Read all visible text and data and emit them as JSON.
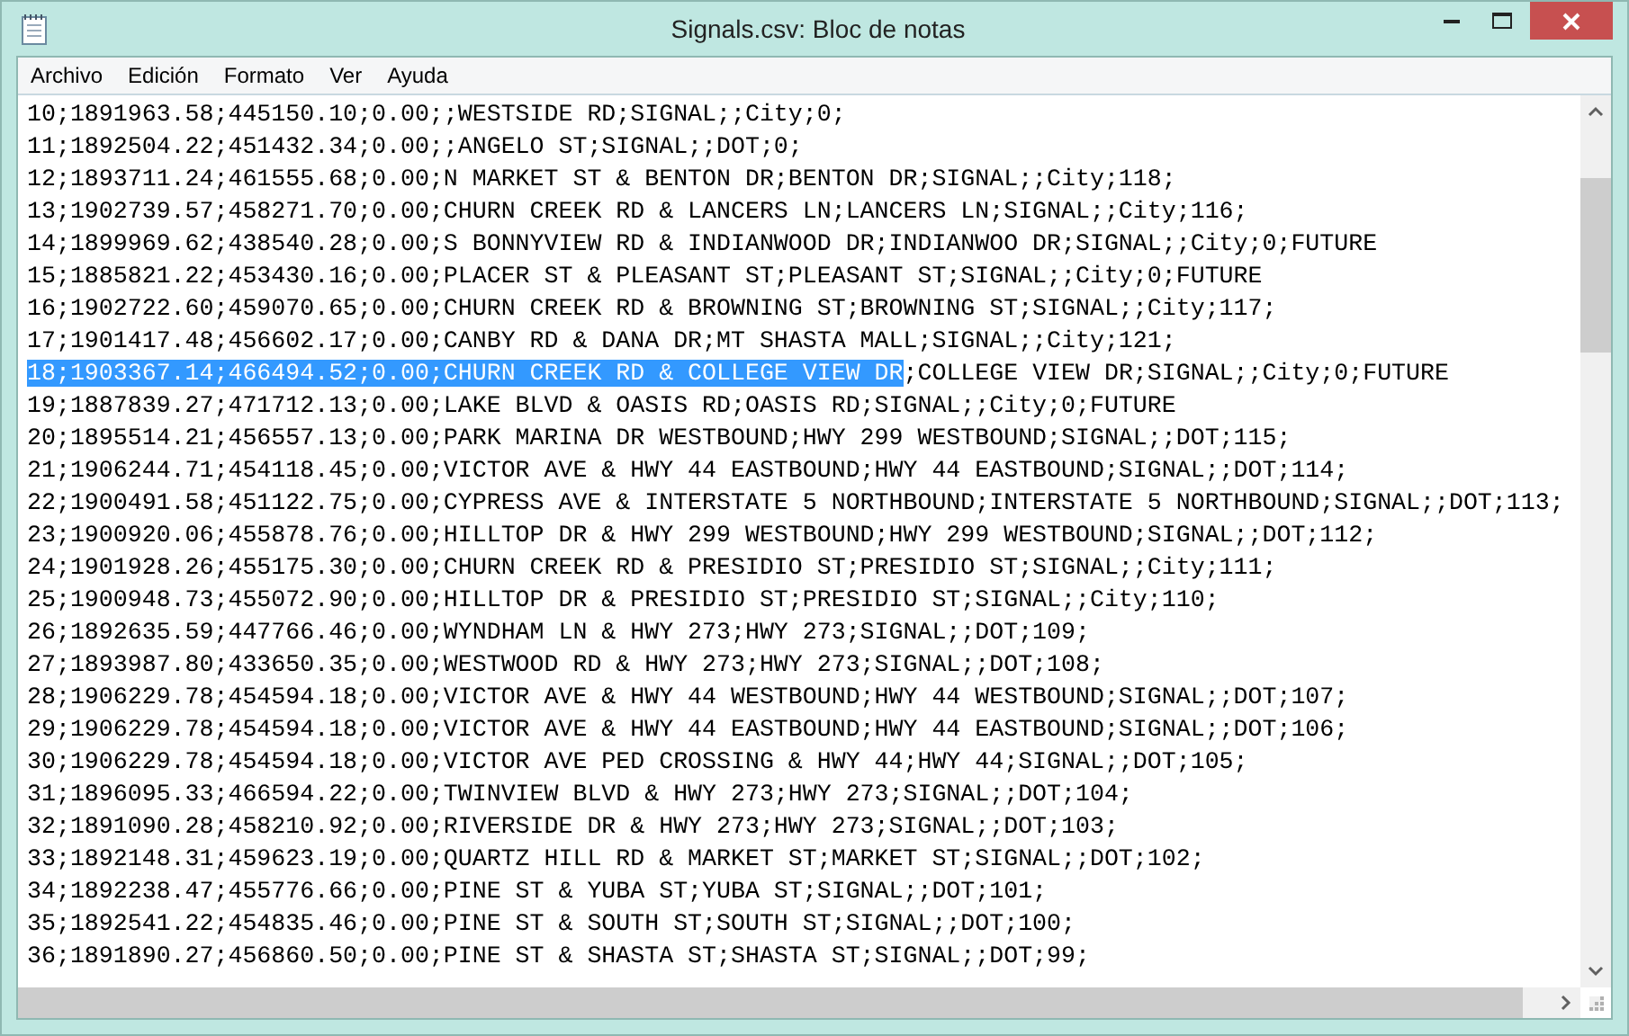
{
  "window": {
    "title": "Signals.csv: Bloc de notas"
  },
  "menu": [
    "Archivo",
    "Edición",
    "Formato",
    "Ver",
    "Ayuda"
  ],
  "lines": [
    {
      "text": "10;1891963.58;445150.10;0.00;;WESTSIDE RD;SIGNAL;;City;0;"
    },
    {
      "text": "11;1892504.22;451432.34;0.00;;ANGELO ST;SIGNAL;;DOT;0;"
    },
    {
      "text": "12;1893711.24;461555.68;0.00;N MARKET ST & BENTON DR;BENTON DR;SIGNAL;;City;118;"
    },
    {
      "text": "13;1902739.57;458271.70;0.00;CHURN CREEK RD & LANCERS LN;LANCERS LN;SIGNAL;;City;116;"
    },
    {
      "text": "14;1899969.62;438540.28;0.00;S BONNYVIEW RD & INDIANWOOD DR;INDIANWOO DR;SIGNAL;;City;0;FUTURE"
    },
    {
      "text": "15;1885821.22;453430.16;0.00;PLACER ST & PLEASANT ST;PLEASANT ST;SIGNAL;;City;0;FUTURE"
    },
    {
      "text": "16;1902722.60;459070.65;0.00;CHURN CREEK RD & BROWNING ST;BROWNING ST;SIGNAL;;City;117;"
    },
    {
      "text": "17;1901417.48;456602.17;0.00;CANBY RD & DANA DR;MT SHASTA MALL;SIGNAL;;City;121;"
    },
    {
      "segments": [
        {
          "text": "18;1903367.14;466494.52;0.00;CHURN CREEK RD & COLLEGE VIEW DR",
          "selected": true
        },
        {
          "text": ";COLLEGE VIEW DR;SIGNAL;;City;0;FUTURE",
          "selected": false
        }
      ]
    },
    {
      "text": "19;1887839.27;471712.13;0.00;LAKE BLVD & OASIS RD;OASIS RD;SIGNAL;;City;0;FUTURE"
    },
    {
      "text": "20;1895514.21;456557.13;0.00;PARK MARINA DR WESTBOUND;HWY 299 WESTBOUND;SIGNAL;;DOT;115;"
    },
    {
      "text": "21;1906244.71;454118.45;0.00;VICTOR AVE & HWY 44 EASTBOUND;HWY 44 EASTBOUND;SIGNAL;;DOT;114;"
    },
    {
      "text": "22;1900491.58;451122.75;0.00;CYPRESS AVE & INTERSTATE 5 NORTHBOUND;INTERSTATE 5 NORTHBOUND;SIGNAL;;DOT;113;"
    },
    {
      "text": "23;1900920.06;455878.76;0.00;HILLTOP DR & HWY 299 WESTBOUND;HWY 299 WESTBOUND;SIGNAL;;DOT;112;"
    },
    {
      "text": "24;1901928.26;455175.30;0.00;CHURN CREEK RD & PRESIDIO ST;PRESIDIO ST;SIGNAL;;City;111;"
    },
    {
      "text": "25;1900948.73;455072.90;0.00;HILLTOP DR & PRESIDIO ST;PRESIDIO ST;SIGNAL;;City;110;"
    },
    {
      "text": "26;1892635.59;447766.46;0.00;WYNDHAM LN & HWY 273;HWY 273;SIGNAL;;DOT;109;"
    },
    {
      "text": "27;1893987.80;433650.35;0.00;WESTWOOD RD & HWY 273;HWY 273;SIGNAL;;DOT;108;"
    },
    {
      "text": "28;1906229.78;454594.18;0.00;VICTOR AVE & HWY 44 WESTBOUND;HWY 44 WESTBOUND;SIGNAL;;DOT;107;"
    },
    {
      "text": "29;1906229.78;454594.18;0.00;VICTOR AVE & HWY 44 EASTBOUND;HWY 44 EASTBOUND;SIGNAL;;DOT;106;"
    },
    {
      "text": "30;1906229.78;454594.18;0.00;VICTOR AVE PED CROSSING & HWY 44;HWY 44;SIGNAL;;DOT;105;"
    },
    {
      "text": "31;1896095.33;466594.22;0.00;TWINVIEW BLVD & HWY 273;HWY 273;SIGNAL;;DOT;104;"
    },
    {
      "text": "32;1891090.28;458210.92;0.00;RIVERSIDE DR & HWY 273;HWY 273;SIGNAL;;DOT;103;"
    },
    {
      "text": "33;1892148.31;459623.19;0.00;QUARTZ HILL RD & MARKET ST;MARKET ST;SIGNAL;;DOT;102;"
    },
    {
      "text": "34;1892238.47;455776.66;0.00;PINE ST & YUBA ST;YUBA ST;SIGNAL;;DOT;101;"
    },
    {
      "text": "35;1892541.22;454835.46;0.00;PINE ST & SOUTH ST;SOUTH ST;SIGNAL;;DOT;100;"
    },
    {
      "text": "36;1891890.27;456860.50;0.00;PINE ST & SHASTA ST;SHASTA ST;SIGNAL;;DOT;99;"
    }
  ]
}
